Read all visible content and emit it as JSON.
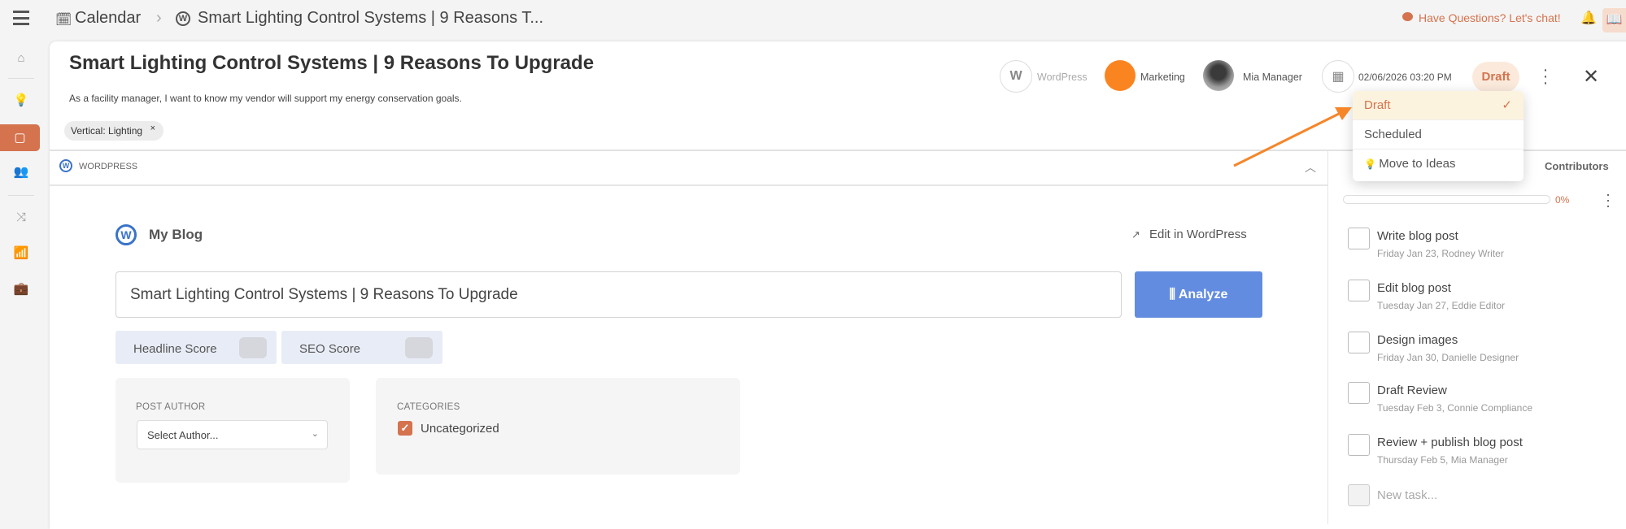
{
  "breadcrumb": {
    "root": "Calendar",
    "current": "Smart Lighting Control Systems | 9 Reasons T..."
  },
  "topbar": {
    "chat": "Have Questions? Let's chat!"
  },
  "header": {
    "title": "Smart Lighting Control Systems | 9 Reasons To Upgrade",
    "description": "As a facility manager, I want to know my vendor will support my energy conservation goals.",
    "tag": "Vertical: Lighting",
    "tag_remove": "×",
    "platform": "WordPress",
    "team": "Marketing",
    "team_color": "#fa8420",
    "owner": "Mia Manager",
    "date": "02/06/2026 03:20 PM",
    "status": "Draft"
  },
  "status_menu": {
    "items": [
      {
        "label": "Draft",
        "selected": true
      },
      {
        "label": "Scheduled"
      },
      {
        "label": "Move to Ideas"
      }
    ]
  },
  "section": {
    "title": "WORDPRESS",
    "blog": "My Blog",
    "edit_link": "Edit in WordPress",
    "title_value": "Smart Lighting Control Systems | 9 Reasons To Upgrade",
    "analyze": "Analyze",
    "headline_score": "Headline Score",
    "seo_score": "SEO Score",
    "post_author_label": "POST AUTHOR",
    "author_placeholder": "Select Author...",
    "categories_label": "CATEGORIES",
    "category": "Uncategorized",
    "category_checked": true
  },
  "tasks": {
    "contributors": "Contributors",
    "progress": "0%",
    "items": [
      {
        "title": "Write blog post",
        "meta": "Friday Jan 23,  Rodney Writer"
      },
      {
        "title": "Edit blog post",
        "meta": "Tuesday Jan 27,  Eddie Editor"
      },
      {
        "title": "Design images",
        "meta": "Friday Jan 30,  Danielle Designer"
      },
      {
        "title": "Draft Review",
        "meta": "Tuesday Feb 3,  Connie Compliance"
      },
      {
        "title": "Review + publish blog post",
        "meta": "Thursday Feb 5,  Mia Manager"
      }
    ],
    "new_placeholder": "New task..."
  },
  "colors": {
    "accent": "#d4734e",
    "primary": "#628ce0",
    "arrow": "#f5862a"
  }
}
